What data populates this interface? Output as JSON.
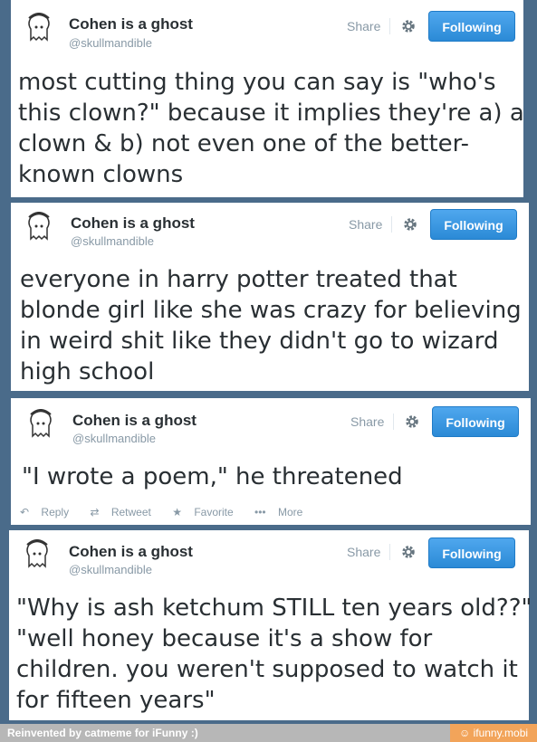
{
  "tweets": [
    {
      "name": "Cohen is a ghost",
      "handle": "@skullmandible",
      "share": "Share",
      "follow": "Following",
      "lines": [
        "most cutting thing you can say is \"who's",
        "this clown?\" because it implies they're a) a",
        "clown & b) not even one of the better-",
        "known clowns"
      ]
    },
    {
      "name": "Cohen is a ghost",
      "handle": "@skullmandible",
      "share": "Share",
      "follow": "Following",
      "lines": [
        "everyone in harry potter treated that",
        "blonde girl like she was crazy for believing",
        "in weird shit like they didn't go to wizard",
        "high school"
      ]
    },
    {
      "name": "Cohen is a ghost",
      "handle": "@skullmandible",
      "share": "Share",
      "follow": "Following",
      "lines": [
        "\"I wrote a poem,\" he threatened"
      ],
      "actions": {
        "reply": "Reply",
        "retweet": "Retweet",
        "favorite": "Favorite",
        "more": "More"
      }
    },
    {
      "name": "Cohen is a ghost",
      "handle": "@skullmandible",
      "share": "Share",
      "follow": "Following",
      "lines": [
        "\"Why is ash ketchum STILL ten years old??\"",
        "\"well honey because it's a show for",
        "children. you weren't supposed to watch it",
        "for fifteen years\""
      ]
    }
  ],
  "footer": {
    "credit": "Reinvented by catmeme for iFunny :)",
    "site": "ifunny.mobi"
  },
  "icons": {
    "avatar": "ghost-avatar-icon",
    "gear": "gear-icon",
    "reply": "reply-icon",
    "retweet": "retweet-icon",
    "favorite": "star-icon",
    "more": "ellipsis-icon",
    "site": "smiley-icon"
  },
  "colors": {
    "follow_button": "#2b8ad6",
    "footer_site": "#f2a45a"
  }
}
